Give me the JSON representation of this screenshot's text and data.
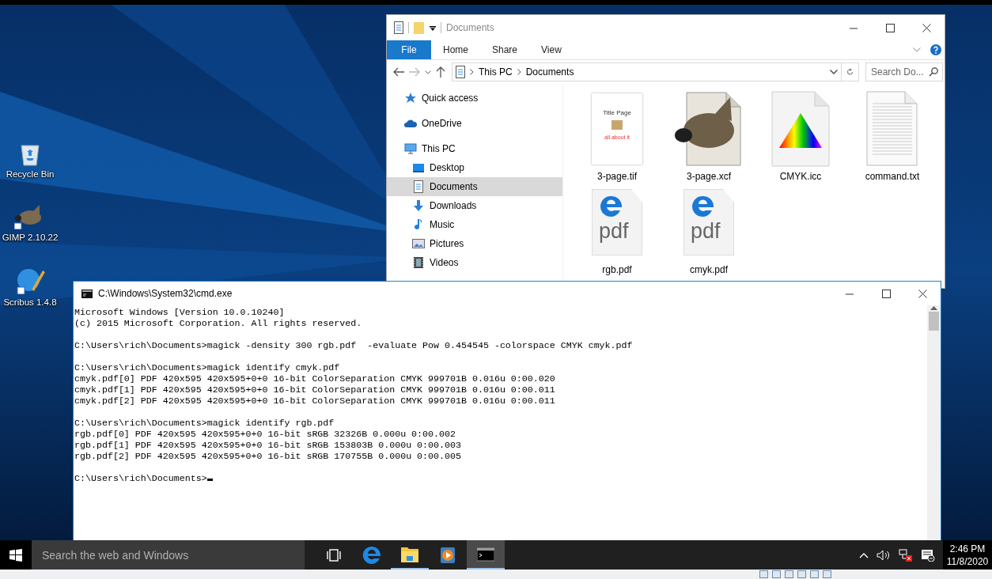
{
  "desktop": {
    "icons": [
      {
        "label": "Recycle Bin",
        "kind": "recycle"
      },
      {
        "label": "GIMP 2.10.22",
        "kind": "gimp"
      },
      {
        "label": "Scribus 1.4.8",
        "kind": "scribus"
      }
    ]
  },
  "explorer": {
    "title": "Documents",
    "ribbon_tabs": [
      {
        "label": "File",
        "kind": "menu"
      },
      {
        "label": "Home",
        "kind": "tab"
      },
      {
        "label": "Share",
        "kind": "tab"
      },
      {
        "label": "View",
        "kind": "tab"
      }
    ],
    "breadcrumb": [
      "This PC",
      "Documents"
    ],
    "search": {
      "placeholder": "Search Do..."
    },
    "nav": [
      {
        "label": "Quick access",
        "kind": "star",
        "selected": false
      },
      {
        "label": "OneDrive",
        "kind": "cloud",
        "selected": false
      },
      {
        "label": "This PC",
        "kind": "pc",
        "selected": false,
        "children": [
          {
            "label": "Desktop",
            "kind": "desktop",
            "selected": false
          },
          {
            "label": "Documents",
            "kind": "documents",
            "selected": true
          },
          {
            "label": "Downloads",
            "kind": "downloads",
            "selected": false
          },
          {
            "label": "Music",
            "kind": "music",
            "selected": false
          },
          {
            "label": "Pictures",
            "kind": "pictures",
            "selected": false
          },
          {
            "label": "Videos",
            "kind": "videos",
            "selected": false
          }
        ]
      }
    ],
    "files": [
      {
        "name": "3-page.tif",
        "kind": "thumbnail",
        "thumb_title": "Title Page",
        "thumb_caption": "all about it"
      },
      {
        "name": "3-page.xcf",
        "kind": "xcf"
      },
      {
        "name": "CMYK.icc",
        "kind": "icc"
      },
      {
        "name": "command.txt",
        "kind": "txt"
      },
      {
        "name": "rgb.pdf",
        "kind": "pdf",
        "badge": "pdf"
      },
      {
        "name": "cmyk.pdf",
        "kind": "pdf",
        "badge": "pdf"
      }
    ]
  },
  "cmd": {
    "title": "C:\\Windows\\System32\\cmd.exe",
    "blocks": [
      [
        "Microsoft Windows [Version 10.0.10240]",
        "(c) 2015 Microsoft Corporation. All rights reserved."
      ],
      [
        "C:\\Users\\rich\\Documents>magick -density 300 rgb.pdf  -evaluate Pow 0.454545 -colorspace CMYK cmyk.pdf"
      ],
      [
        "C:\\Users\\rich\\Documents>magick identify cmyk.pdf",
        "cmyk.pdf[0] PDF 420x595 420x595+0+0 16-bit ColorSeparation CMYK 999701B 0.016u 0:00.020",
        "cmyk.pdf[1] PDF 420x595 420x595+0+0 16-bit ColorSeparation CMYK 999701B 0.016u 0:00.011",
        "cmyk.pdf[2] PDF 420x595 420x595+0+0 16-bit ColorSeparation CMYK 999701B 0.016u 0:00.011"
      ],
      [
        "C:\\Users\\rich\\Documents>magick identify rgb.pdf",
        "rgb.pdf[0] PDF 420x595 420x595+0+0 16-bit sRGB 32326B 0.000u 0:00.002",
        "rgb.pdf[1] PDF 420x595 420x595+0+0 16-bit sRGB 153803B 0.000u 0:00.003",
        "rgb.pdf[2] PDF 420x595 420x595+0+0 16-bit sRGB 170755B 0.000u 0:00.005"
      ],
      [
        "C:\\Users\\rich\\Documents>"
      ]
    ],
    "cursor": true
  },
  "taskbar": {
    "search": {
      "placeholder": "Search the web and Windows"
    },
    "apps": [
      {
        "kind": "taskview",
        "open": false,
        "selected": false
      },
      {
        "kind": "edge",
        "open": false,
        "selected": false
      },
      {
        "kind": "explorer",
        "open": true,
        "selected": false
      },
      {
        "kind": "media",
        "open": false,
        "selected": false
      },
      {
        "kind": "cmd",
        "open": true,
        "selected": true
      }
    ],
    "tray": [
      {
        "kind": "chevron"
      },
      {
        "kind": "volume"
      },
      {
        "kind": "network"
      },
      {
        "kind": "notifications"
      }
    ],
    "clock": {
      "time": "2:46 PM",
      "date": "11/8/2020"
    }
  }
}
